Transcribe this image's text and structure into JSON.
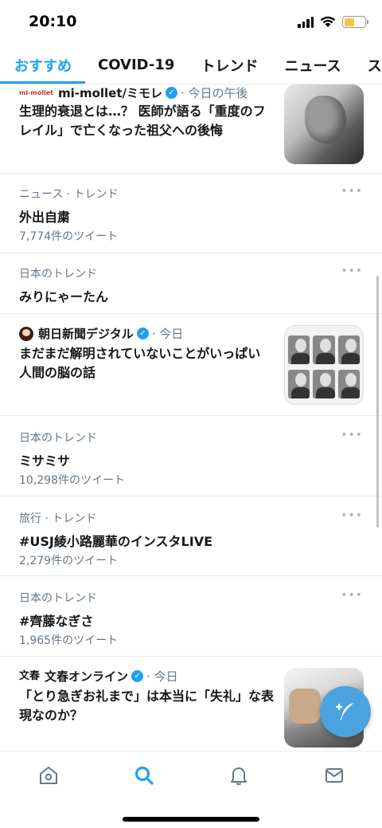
{
  "status_bar": {
    "time": "20:10",
    "battery_level": 0.5,
    "battery_color": "#f4c542"
  },
  "tabs": [
    {
      "label": "おすすめ",
      "active": true
    },
    {
      "label": "COVID-19",
      "active": false
    },
    {
      "label": "トレンド",
      "active": false
    },
    {
      "label": "ニュース",
      "active": false
    },
    {
      "label": "スポー",
      "active": false
    }
  ],
  "accent_color": "#1da1f2",
  "feed": {
    "news1": {
      "source_logo_text": "mi-mollet",
      "source": "mi-mollet/ミモレ",
      "time": "· 今日の午後",
      "title": "生理的衰退とは…？ 医師が語る「重度のフレイル」で亡くなった祖父への後悔"
    },
    "trend1": {
      "category": "ニュース · トレンド",
      "title": "外出自粛",
      "count": "7,774件のツイート"
    },
    "trend2": {
      "category": "日本のトレンド",
      "title": "みりにゃーたん"
    },
    "news2": {
      "source": "朝日新聞デジタル",
      "time": "· 今日",
      "title": "まだまだ解明されていないことがいっぱい　人間の脳の話"
    },
    "trend3": {
      "category": "日本のトレンド",
      "title": "ミサミサ",
      "count": "10,298件のツイート"
    },
    "trend4": {
      "category": "旅行 · トレンド",
      "title": "#USJ綾小路麗華のインスタLIVE",
      "count": "2,279件のツイート"
    },
    "trend5": {
      "category": "日本のトレンド",
      "title": "#齊藤なぎさ",
      "count": "1,965件のツイート"
    },
    "news3": {
      "source_logo_text": "文春",
      "source": "文春オンライン",
      "time": "· 今日",
      "title": "「とり急ぎお礼まで」は本当に「失礼」な表現なのか？"
    },
    "more_label": "•••"
  },
  "bottom_nav": [
    {
      "icon": "home-icon",
      "active": false
    },
    {
      "icon": "search-icon",
      "active": true
    },
    {
      "icon": "bell-icon",
      "active": false
    },
    {
      "icon": "mail-icon",
      "active": false
    }
  ]
}
